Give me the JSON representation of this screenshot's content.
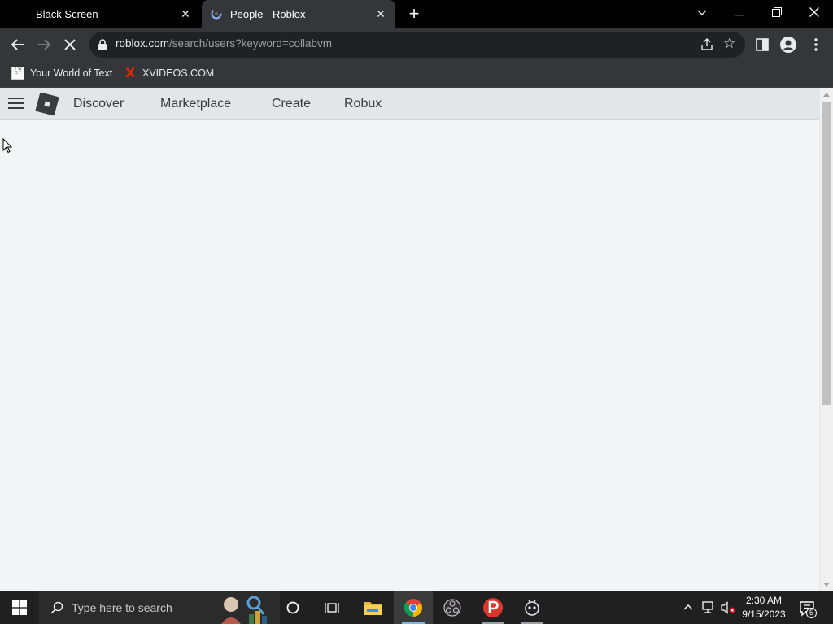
{
  "browser": {
    "tabs": [
      {
        "title": "Black Screen",
        "active": false
      },
      {
        "title": "People - Roblox",
        "active": true
      }
    ],
    "new_tab_label": "+",
    "url_host": "roblox.com",
    "url_path": "/search/users?keyword=collabvm",
    "bookmarks": [
      {
        "label": "Your World of Text",
        "favicon_text": "Y W O T"
      },
      {
        "label": "XVIDEOS.COM",
        "favicon_text": "X"
      }
    ]
  },
  "page": {
    "nav": {
      "discover": "Discover",
      "marketplace": "Marketplace",
      "create": "Create",
      "robux": "Robux"
    }
  },
  "taskbar": {
    "search_placeholder": "Type here to search",
    "clock_time": "2:30 AM",
    "clock_date": "9/15/2023",
    "notification_count": "5"
  },
  "colors": {
    "tab_strip": "#000000",
    "toolbar": "#35363a",
    "omnibox": "#202124",
    "roblox_header": "#e3e6e8",
    "page_bg": "#f2f4f5",
    "taskbar": "#202020"
  }
}
